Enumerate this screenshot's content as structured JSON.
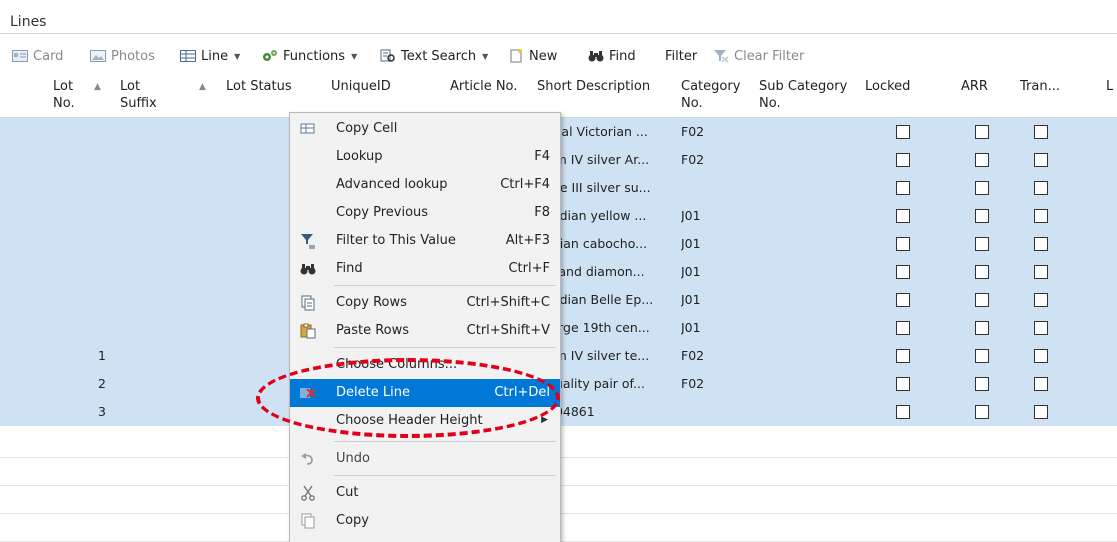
{
  "window": {
    "title": "Lines"
  },
  "toolbar": {
    "card": "Card",
    "photos": "Photos",
    "line": "Line",
    "functions": "Functions",
    "text_search": "Text Search",
    "new": "New",
    "find": "Find",
    "filter": "Filter",
    "clear_filter": "Clear Filter"
  },
  "columns": {
    "lot_no": [
      "Lot",
      "No."
    ],
    "lot_suffix": [
      "Lot",
      "Suffix"
    ],
    "lot_status": "Lot Status",
    "unique_id": "UniqueID",
    "article_no": "Article No.",
    "short_description": "Short Description",
    "category_no": [
      "Category",
      "No."
    ],
    "sub_category_no": [
      "Sub Category",
      "No."
    ],
    "locked": "Locked",
    "arr": "ARR",
    "tran": "Tran...",
    "extra": "L"
  },
  "rows": [
    {
      "lot": "",
      "desc": "sual Victorian ...",
      "cat": "F02"
    },
    {
      "lot": "",
      "desc": "am IV silver Ar...",
      "cat": "F02"
    },
    {
      "lot": "",
      "desc": "rge III silver su...",
      "cat": ""
    },
    {
      "lot": "",
      "desc": "ardian yellow ...",
      "cat": "J01"
    },
    {
      "lot": "",
      "desc": "orian cabocho...",
      "cat": "J01"
    },
    {
      "lot": "",
      "desc": "y and diamon...",
      "cat": "J01"
    },
    {
      "lot": "",
      "desc": "ardian Belle Ep...",
      "cat": "J01"
    },
    {
      "lot": "",
      "desc": "large 19th cen...",
      "cat": "J01"
    },
    {
      "lot": "1",
      "desc": "am IV silver te...",
      "cat": "F02"
    },
    {
      "lot": "2",
      "desc": "quality pair of...",
      "cat": "F02"
    },
    {
      "lot": "3",
      "desc": "004861",
      "cat": ""
    }
  ],
  "context_menu": {
    "copy_cell": "Copy Cell",
    "lookup": "Lookup",
    "lookup_key": "F4",
    "advanced_lookup": "Advanced lookup",
    "advanced_lookup_key": "Ctrl+F4",
    "copy_previous": "Copy Previous",
    "copy_previous_key": "F8",
    "filter_to_value": "Filter to This Value",
    "filter_to_value_key": "Alt+F3",
    "find": "Find",
    "find_key": "Ctrl+F",
    "copy_rows": "Copy Rows",
    "copy_rows_key": "Ctrl+Shift+C",
    "paste_rows": "Paste Rows",
    "paste_rows_key": "Ctrl+Shift+V",
    "choose_columns": "Choose Columns...",
    "delete_line": "Delete Line",
    "delete_line_key": "Ctrl+Del",
    "choose_header_height": "Choose Header Height",
    "undo": "Undo",
    "cut": "Cut",
    "copy": "Copy"
  },
  "colors": {
    "selection": "#cfe2f3",
    "menu_highlight": "#0078d7",
    "annotation": "#e0001b"
  }
}
